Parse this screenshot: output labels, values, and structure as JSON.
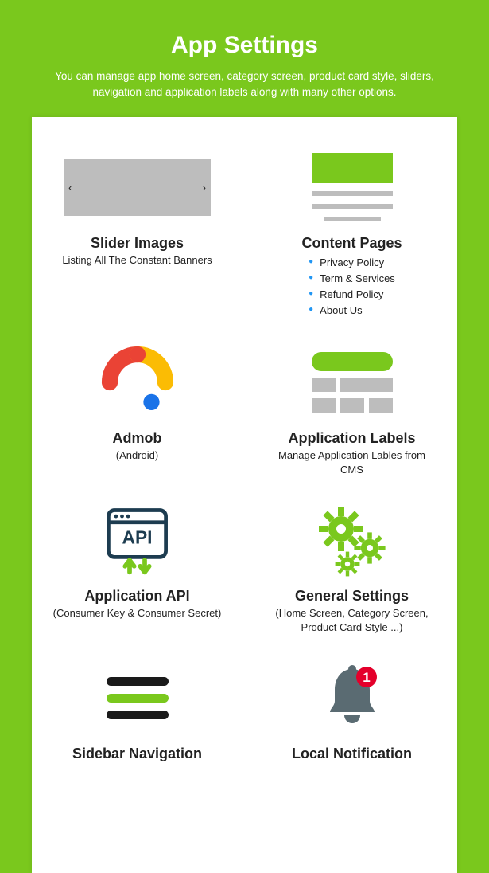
{
  "header": {
    "title": "App Settings",
    "subtitle": "You can manage app home screen, category screen, product card style, sliders, navigation and application labels along with many other options."
  },
  "cells": {
    "slider": {
      "title": "Slider Images",
      "subtitle": "Listing All The Constant Banners"
    },
    "content": {
      "title": "Content Pages",
      "items": [
        "Privacy Policy",
        "Term & Services",
        "Refund Policy",
        "About Us"
      ]
    },
    "admob": {
      "title": "Admob",
      "subtitle": "(Android)"
    },
    "labels": {
      "title": "Application Labels",
      "subtitle": "Manage Application Lables from CMS"
    },
    "api": {
      "title": "Application API",
      "subtitle": "(Consumer Key & Consumer Secret)"
    },
    "general": {
      "title": "General Settings",
      "subtitle": "(Home Screen, Category Screen, Product Card Style ...)"
    },
    "sidebar": {
      "title": "Sidebar Navigation"
    },
    "notification": {
      "title": "Local Notification",
      "badge": "1"
    }
  }
}
